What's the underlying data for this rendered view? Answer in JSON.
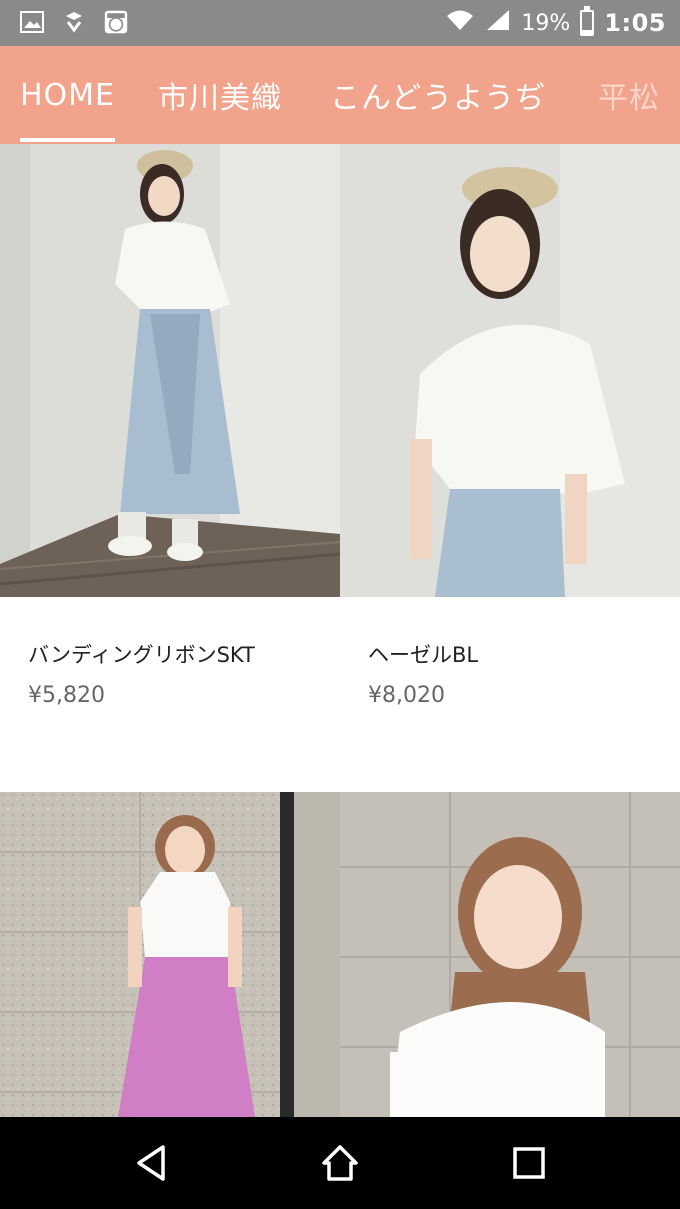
{
  "status_bar": {
    "icons": [
      "image-icon",
      "download-icon",
      "app-icon",
      "wifi-icon",
      "signal-icon"
    ],
    "battery": "19%",
    "battery_level": 0.19,
    "time": "1:05"
  },
  "tabs": [
    {
      "label": "HOME",
      "active": true
    },
    {
      "label": "市川美織",
      "active": false
    },
    {
      "label": "こんどうようぢ",
      "active": false
    },
    {
      "label": "平松",
      "active": false
    }
  ],
  "products": [
    {
      "name": "バンディングリボンSKT",
      "price": "¥5,820"
    },
    {
      "name": "ヘーゼルBL",
      "price": "¥8,020"
    },
    {
      "name": "",
      "price": ""
    },
    {
      "name": "",
      "price": ""
    }
  ],
  "nav": {
    "icons": [
      "back-icon",
      "home-icon",
      "recents-icon"
    ]
  }
}
